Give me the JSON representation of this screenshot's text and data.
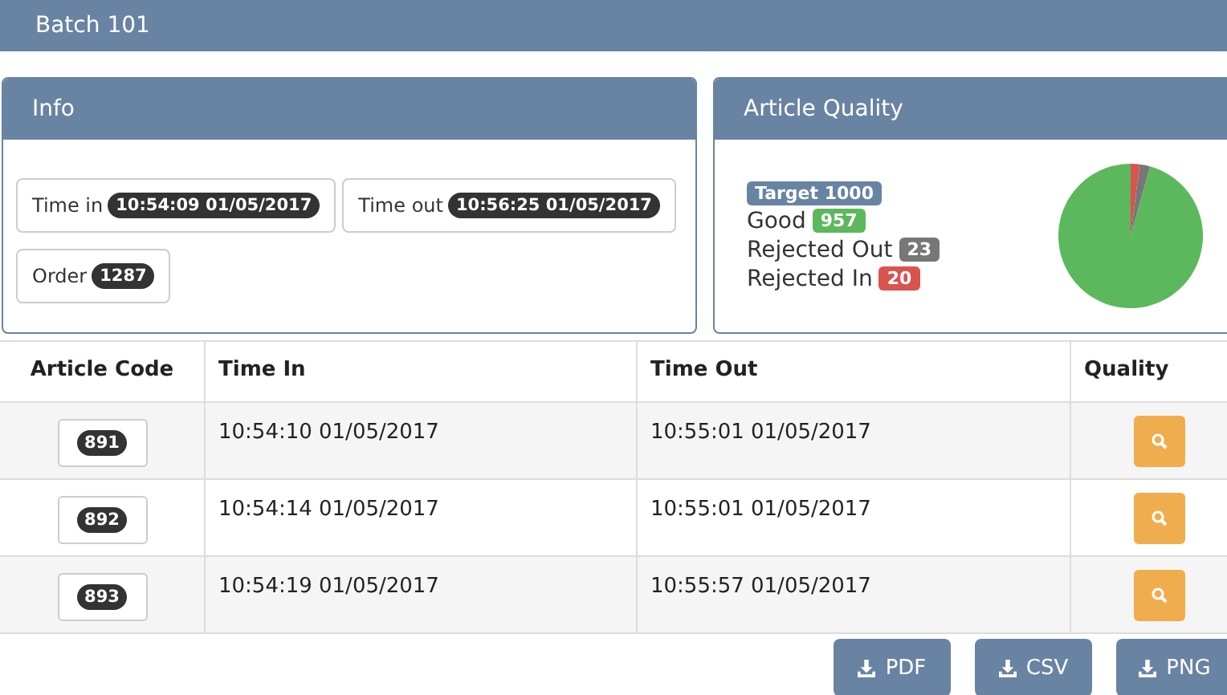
{
  "header": {
    "title": "Batch 101"
  },
  "info": {
    "title": "Info",
    "items": [
      {
        "label": "Time in",
        "value": "10:54:09 01/05/2017"
      },
      {
        "label": "Time out",
        "value": "10:56:25 01/05/2017"
      },
      {
        "label": "Order",
        "value": "1287"
      }
    ]
  },
  "quality": {
    "title": "Article Quality",
    "target": "Target 1000",
    "stats": [
      {
        "label": "Good",
        "value": "957",
        "color": "#5cb85c"
      },
      {
        "label": "Rejected Out",
        "value": "23",
        "color": "#777777"
      },
      {
        "label": "Rejected In",
        "value": "20",
        "color": "#d9534f"
      }
    ]
  },
  "table": {
    "columns": [
      "Article Code",
      "Time In",
      "Time Out",
      "Quality"
    ],
    "rows": [
      {
        "code": "891",
        "time_in": "10:54:10 01/05/2017",
        "time_out": "10:55:01 01/05/2017"
      },
      {
        "code": "892",
        "time_in": "10:54:14 01/05/2017",
        "time_out": "10:55:01 01/05/2017"
      },
      {
        "code": "893",
        "time_in": "10:54:19 01/05/2017",
        "time_out": "10:55:57 01/05/2017"
      }
    ]
  },
  "exports": [
    "PDF",
    "CSV",
    "PNG"
  ]
}
